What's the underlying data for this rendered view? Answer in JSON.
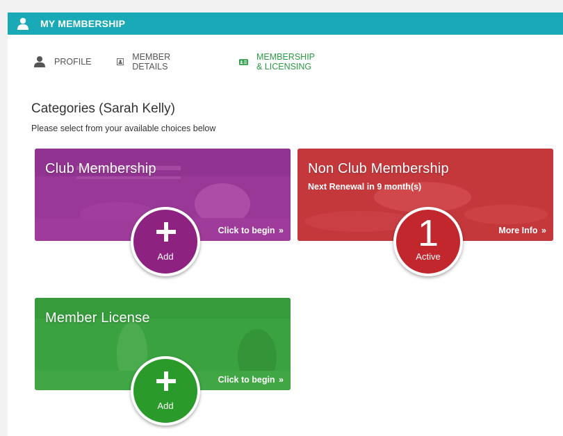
{
  "header": {
    "title": "MY MEMBERSHIP",
    "icon": "user-icon",
    "color": "#19a9b7"
  },
  "tabs": [
    {
      "label": "PROFILE",
      "icon": "profile-icon"
    },
    {
      "label": "MEMBER DETAILS",
      "icon": "id-card-icon"
    },
    {
      "label": "MEMBERSHIP & LICENSING",
      "icon": "membership-card-icon",
      "active": true
    }
  ],
  "section": {
    "title": "Categories (Sarah Kelly)",
    "subtitle": "Please select from your available choices below"
  },
  "cards": [
    {
      "title": "Club Membership",
      "subtitle": "",
      "link": "Click to begin",
      "badge": {
        "label": "Add",
        "icon": "plus-icon",
        "color": "#8e2280"
      },
      "color": "#a0349a"
    },
    {
      "title": "Non Club Membership",
      "subtitle": "Next Renewal in 9 month(s)",
      "link": "More Info",
      "badge": {
        "count": "1",
        "label": "Active",
        "color": "#c1272d"
      },
      "color": "#c8393d"
    },
    {
      "title": "Member License",
      "subtitle": "",
      "link": "Click to begin",
      "badge": {
        "label": "Add",
        "icon": "plus-icon",
        "color": "#2a9a2a"
      },
      "color": "#3aa63a"
    }
  ],
  "chevron": "»"
}
